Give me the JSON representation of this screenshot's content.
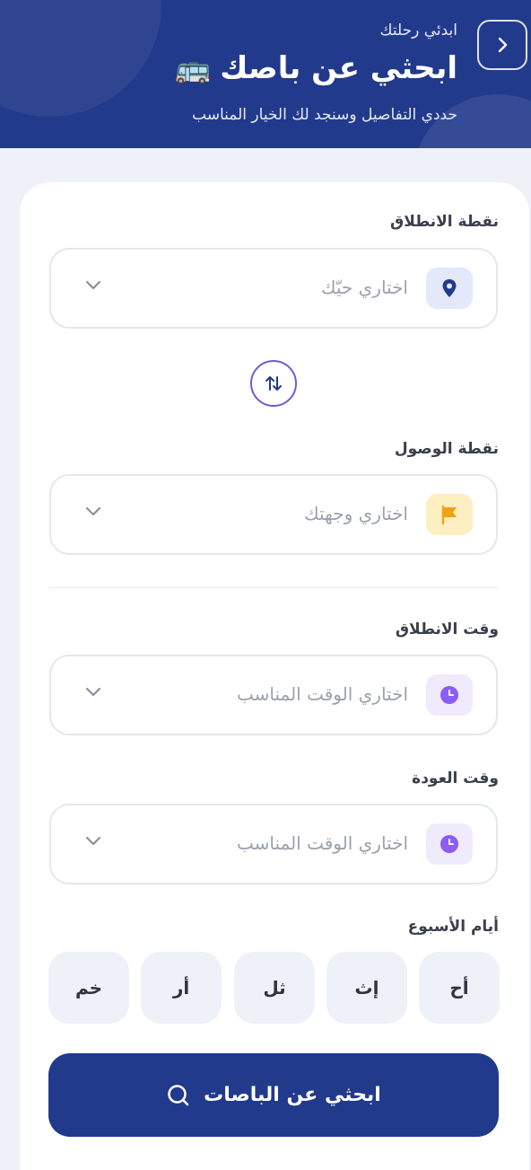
{
  "header": {
    "kicker": "ابدئي رحلتك",
    "title": "ابحثي عن باصك",
    "title_emoji": "🚌",
    "subtitle": "حددي التفاصيل وسنجد لك الخيار المناسب",
    "back_icon": "chevron-right-icon"
  },
  "form": {
    "origin": {
      "label": "نقطة الانطلاق",
      "placeholder": "اختاري حيّك",
      "icon": "location-pin-icon"
    },
    "destination": {
      "label": "نقطة الوصول",
      "placeholder": "اختاري وجهتك",
      "icon": "flag-icon"
    },
    "departure_time": {
      "label": "وقت الانطلاق",
      "placeholder": "اختاري الوقت المناسب",
      "icon": "clock-icon"
    },
    "return_time": {
      "label": "وقت العودة",
      "placeholder": "اختاري الوقت المناسب",
      "icon": "clock-icon"
    },
    "swap_icon": "swap-vertical-icon"
  },
  "weekdays": {
    "label": "أيام الأسبوع",
    "days": [
      "أح",
      "إث",
      "ثل",
      "أر",
      "خم"
    ]
  },
  "search_button": {
    "label": "ابحثي عن الباصات",
    "icon": "search-icon"
  },
  "colors": {
    "primary": "#223a8c",
    "swap_accent": "#6b5fd0",
    "origin_icon_bg": "#e4e8fb",
    "flag_icon_bg": "#fdefc2",
    "clock_icon_bg": "#efeafc"
  }
}
